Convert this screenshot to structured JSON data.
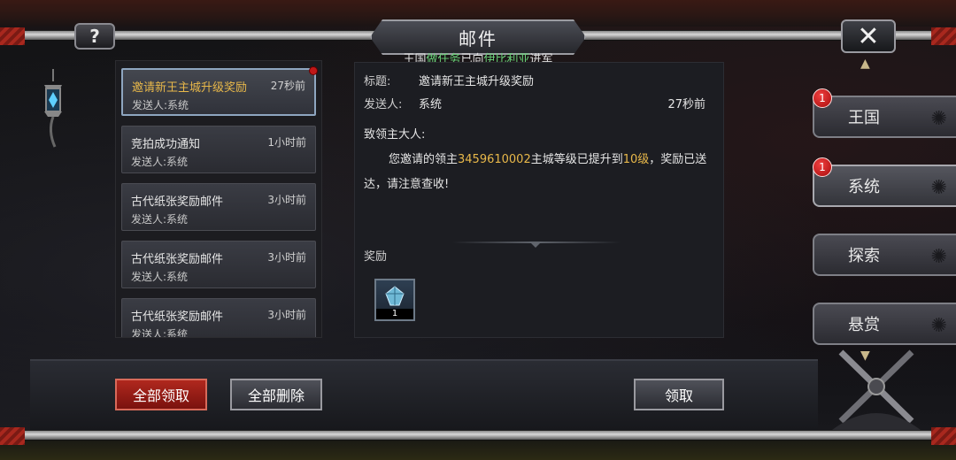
{
  "header": {
    "title": "邮件",
    "help_label": "?",
    "close_label": "✕"
  },
  "ticker": {
    "part1": "王国",
    "highlight1": "做任务",
    "part2": "已向",
    "highlight2": "伊比利亚",
    "part3": "进军"
  },
  "mail_list": [
    {
      "subject": "邀请新王主城升级奖励",
      "time": "27秒前",
      "sender": "发送人:系统",
      "selected": true,
      "unread": true
    },
    {
      "subject": "竞拍成功通知",
      "time": "1小时前",
      "sender": "发送人:系统",
      "selected": false,
      "unread": false
    },
    {
      "subject": "古代纸张奖励邮件",
      "time": "3小时前",
      "sender": "发送人:系统",
      "selected": false,
      "unread": false
    },
    {
      "subject": "古代纸张奖励邮件",
      "time": "3小时前",
      "sender": "发送人:系统",
      "selected": false,
      "unread": false
    },
    {
      "subject": "古代纸张奖励邮件",
      "time": "3小时前",
      "sender": "发送人:系统",
      "selected": false,
      "unread": false
    }
  ],
  "detail": {
    "title_label": "标题:",
    "title_value": "邀请新王主城升级奖励",
    "sender_label": "发送人:",
    "sender_value": "系统",
    "time": "27秒前",
    "greeting": "致领主大人:",
    "body_pre": "您邀请的领主",
    "body_id": "3459610002",
    "body_mid": "主城等级已提升到",
    "body_level": "10级",
    "body_post": "，奖励已送达，请注意查收!",
    "reward_label": "奖励",
    "reward_qty": "1"
  },
  "tabs": [
    {
      "label": "王国",
      "badge": "1"
    },
    {
      "label": "系统",
      "badge": "1"
    },
    {
      "label": "探索",
      "badge": ""
    },
    {
      "label": "悬赏",
      "badge": ""
    }
  ],
  "buttons": {
    "claim_all": "全部领取",
    "delete_all": "全部删除",
    "claim": "领取"
  },
  "colors": {
    "highlight_gold": "#e8b84a",
    "highlight_green": "#6ad47a",
    "badge_red": "#c01818",
    "claim_all_red": "#b0281e"
  },
  "icons": {
    "help": "question-icon",
    "close": "close-icon",
    "lantern": "lantern-icon",
    "reward": "gem-icon"
  }
}
